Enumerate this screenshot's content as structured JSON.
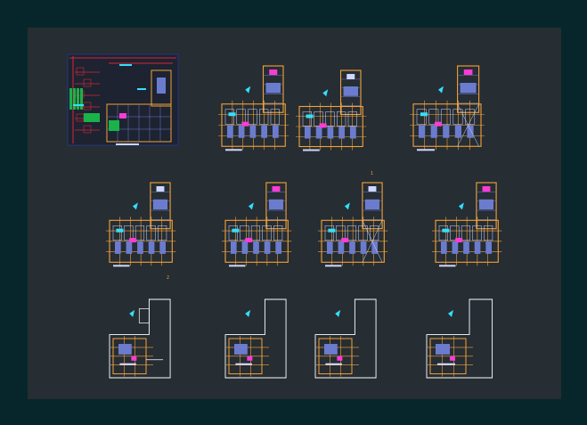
{
  "viewer": {
    "title": "",
    "background": "#07262b",
    "sheet_color": "#262d33"
  },
  "colors": {
    "wall": "#f2a23a",
    "structure": "#ffffff",
    "interior": "#6b7ccf",
    "detail": "#cfd6ff",
    "accent_cyan": "#33e0ff",
    "accent_magenta": "#ff3bd6",
    "site_red": "#d7263d",
    "site_green": "#19b34a",
    "site_blue": "#2a3fb8"
  },
  "sheet": {
    "marks": [
      "1",
      "2"
    ],
    "plans": [
      {
        "name": "site-plan",
        "kind": "site"
      },
      {
        "name": "plan-row1-a",
        "kind": "detailed"
      },
      {
        "name": "plan-row1-b",
        "kind": "detailed"
      },
      {
        "name": "plan-row1-c",
        "kind": "detailed"
      },
      {
        "name": "plan-row2-a",
        "kind": "detailed"
      },
      {
        "name": "plan-row2-b",
        "kind": "detailed"
      },
      {
        "name": "plan-row2-c",
        "kind": "detailed"
      },
      {
        "name": "plan-row2-d",
        "kind": "detailed"
      },
      {
        "name": "plan-row3-a",
        "kind": "outline"
      },
      {
        "name": "plan-row3-b",
        "kind": "outline"
      },
      {
        "name": "plan-row3-c",
        "kind": "outline"
      },
      {
        "name": "plan-row3-d",
        "kind": "outline"
      }
    ]
  }
}
